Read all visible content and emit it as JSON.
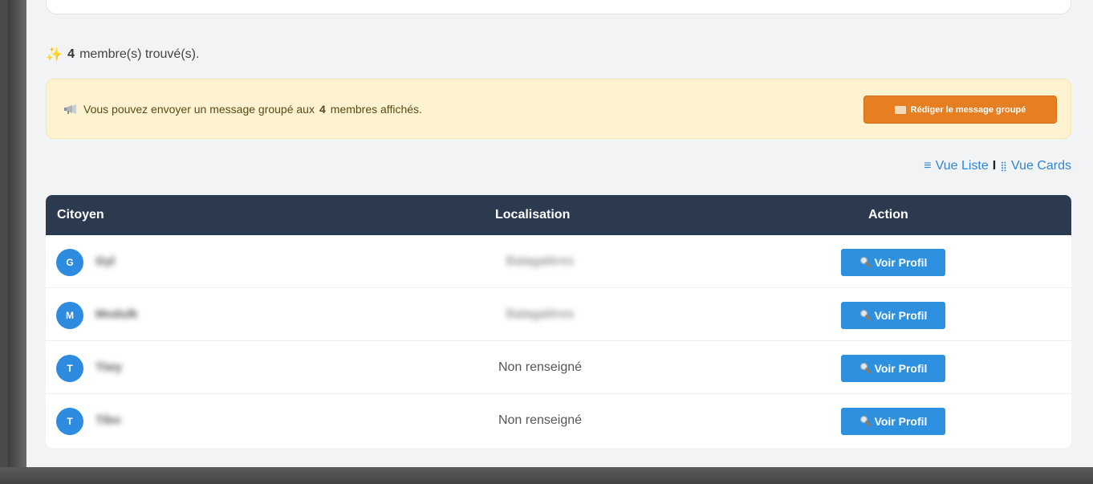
{
  "summary": {
    "count": "4",
    "count_suffix": "membre(s) trouvé(s)."
  },
  "notice": {
    "text_before": "Vous pouvez envoyer un message groupé aux",
    "count": "4",
    "text_after": "membres affichés.",
    "compose_label": "Rédiger le message groupé"
  },
  "view_switch": {
    "list_label": "Vue Liste",
    "separator": "I",
    "cards_label": "Vue Cards"
  },
  "table": {
    "headers": {
      "citizen": "Citoyen",
      "location": "Localisation",
      "action": "Action"
    },
    "rows": [
      {
        "initial": "G",
        "name": "Gyl",
        "location": "Balagalères",
        "location_blurred": true,
        "action_label": "Voir Profil"
      },
      {
        "initial": "M",
        "name": "Modulk",
        "location": "Balagalères",
        "location_blurred": true,
        "action_label": "Voir Profil"
      },
      {
        "initial": "T",
        "name": "Tiwy",
        "location": "Non renseigné",
        "location_blurred": false,
        "action_label": "Voir Profil"
      },
      {
        "initial": "T",
        "name": "Tibo",
        "location": "Non renseigné",
        "location_blurred": false,
        "action_label": "Voir Profil"
      }
    ]
  },
  "colors": {
    "header_bg": "#2b3a4f",
    "button_blue": "#2e91e0",
    "compose_orange": "#e67e22",
    "notice_bg": "#fdf3d0",
    "link_blue": "#2e86d9"
  },
  "icons": {
    "sparkle": "sparkle-icon",
    "megaphone": "megaphone-icon",
    "envelope": "envelope-icon",
    "list": "list-icon",
    "grid": "grid-icon",
    "magnifier": "magnifier-icon"
  }
}
